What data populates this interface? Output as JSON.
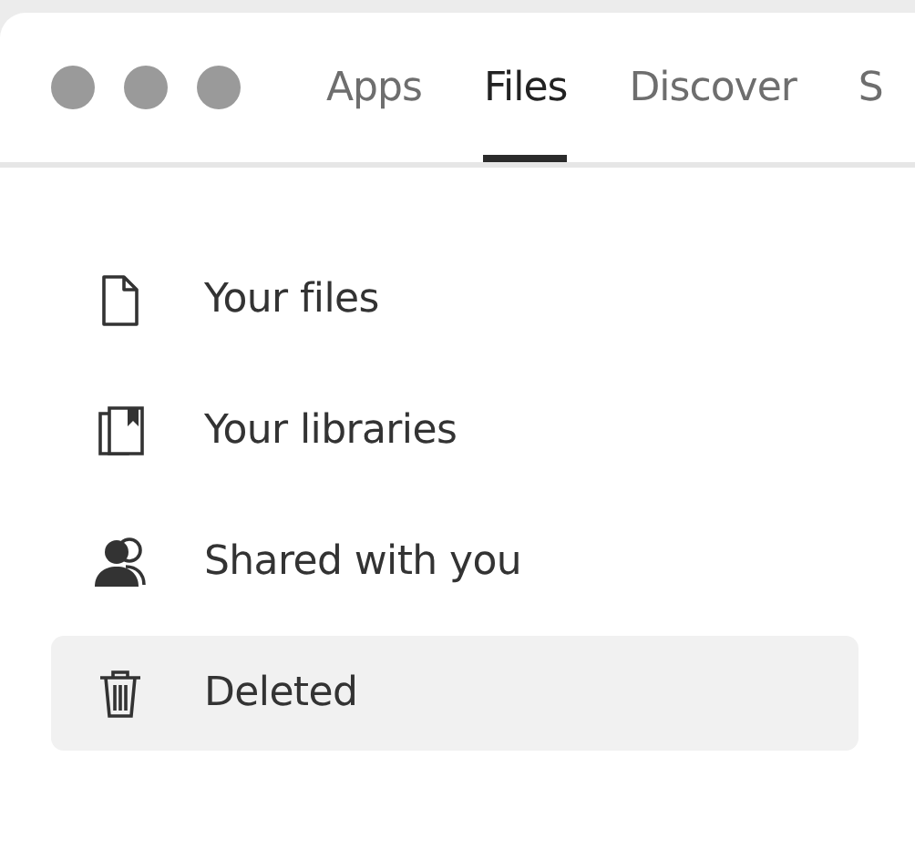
{
  "tabs": [
    {
      "label": "Apps",
      "selected": false
    },
    {
      "label": "Files",
      "selected": true
    },
    {
      "label": "Discover",
      "selected": false
    },
    {
      "label": "S",
      "selected": false
    }
  ],
  "sidebar": {
    "items": [
      {
        "label": "Your files",
        "kind": "file",
        "selected": false
      },
      {
        "label": "Your libraries",
        "kind": "library",
        "selected": false
      },
      {
        "label": "Shared with you",
        "kind": "shared",
        "selected": false
      },
      {
        "label": "Deleted",
        "kind": "trash",
        "selected": true
      }
    ]
  }
}
